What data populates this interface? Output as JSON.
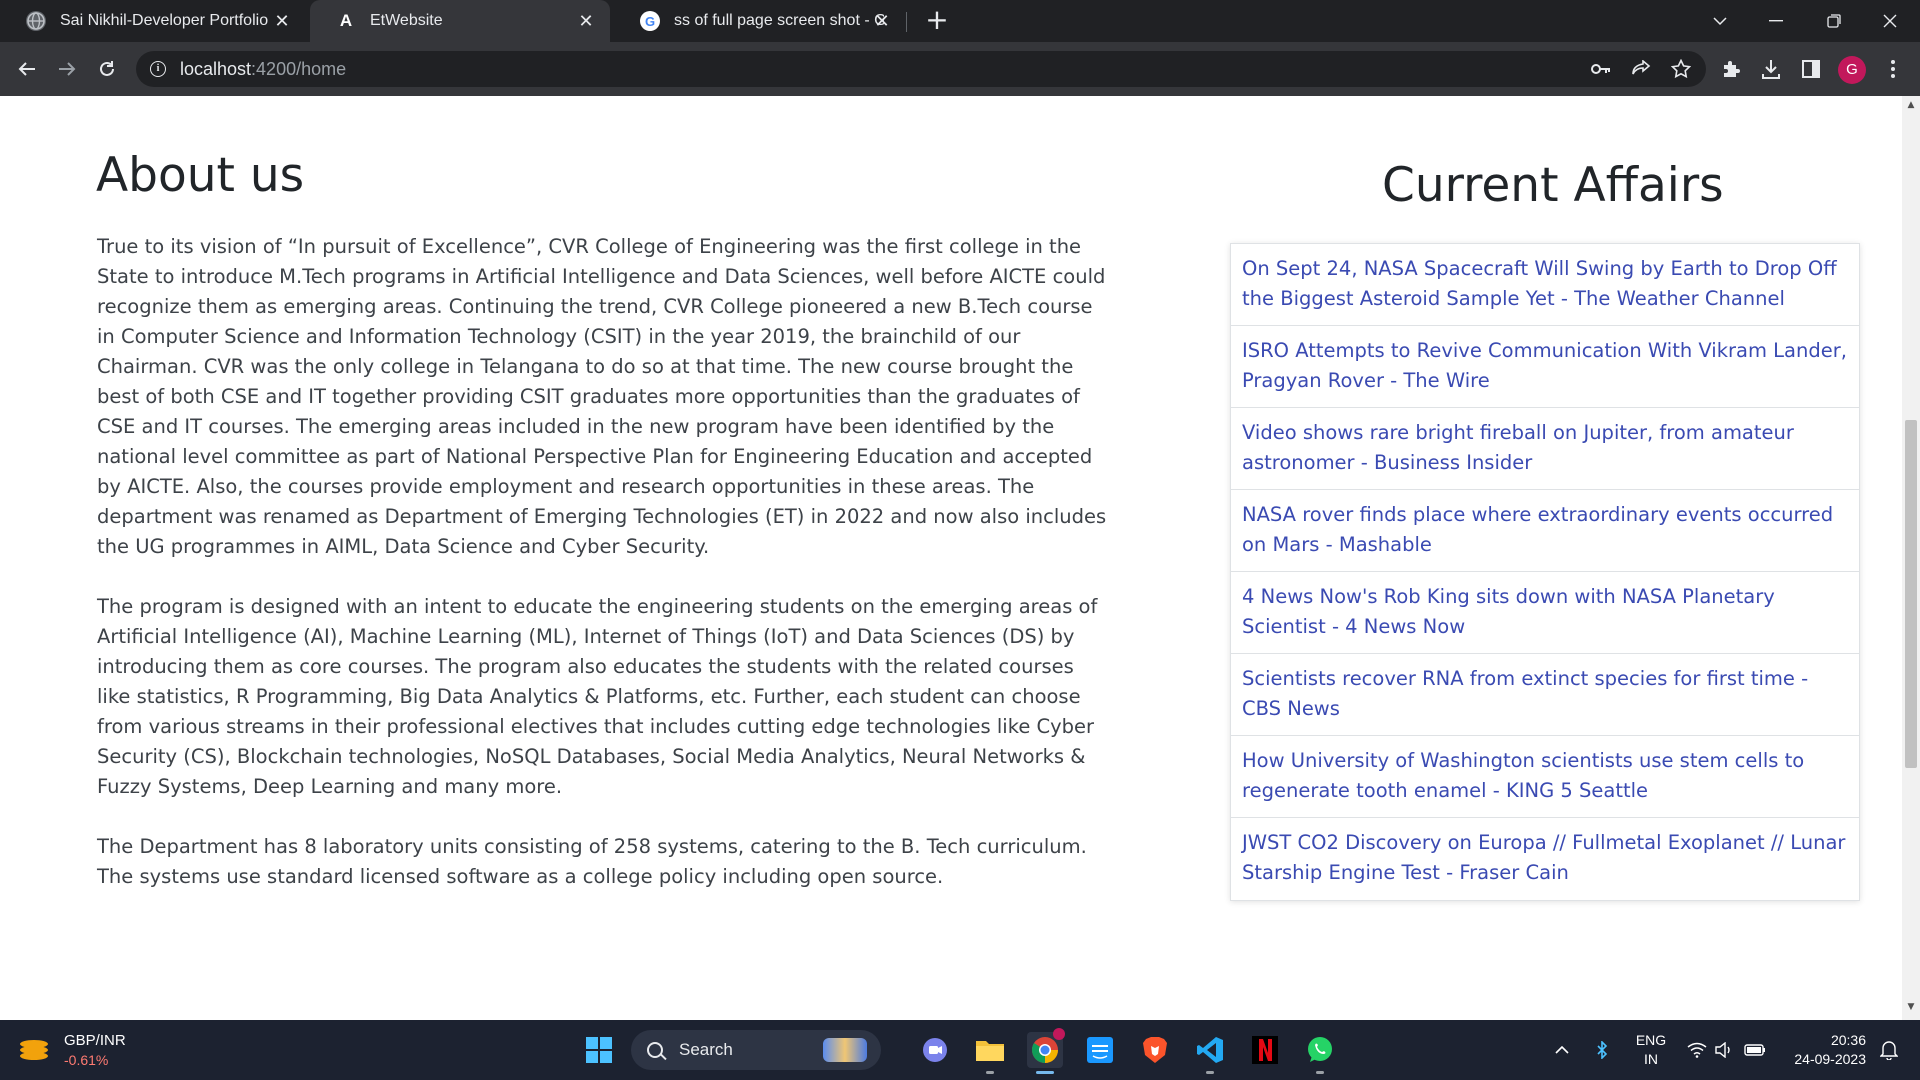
{
  "browser": {
    "tabs": [
      {
        "title": "Sai Nikhil-Developer Portfolio",
        "icon": "globe-icon",
        "active": false
      },
      {
        "title": "EtWebsite",
        "icon": "angular-icon",
        "active": true
      },
      {
        "title": "ss of full page screen shot - Goo",
        "icon": "google-icon",
        "active": false
      }
    ],
    "url_host": "localhost",
    "url_path": ":4200/home",
    "profile_initial": "G",
    "accent": "#c2185b"
  },
  "page": {
    "about_title": "About us",
    "about_paragraphs": [
      "True to its vision of “In pursuit of Excellence”, CVR College of Engineering was the first college in the State to introduce M.Tech programs in Artificial Intelligence and Data Sciences, well before AICTE could recognize them as emerging areas. Continuing the trend, CVR College pioneered a new B.Tech course in Computer Science and Information Technology (CSIT) in the year 2019, the brainchild of our Chairman. CVR was the only college in Telangana to do so at that time. The new course brought the best of both CSE and IT together providing CSIT graduates more opportunities than the graduates of CSE and IT courses. The emerging areas included in the new program have been identified by the national level committee as part of National Perspective Plan for Engineering Education and accepted by AICTE. Also, the courses provide employment and research opportunities in these areas. The department was renamed as Department of Emerging Technologies (ET) in 2022 and now also includes the UG programmes in AIML, Data Science and Cyber Security.",
      "The program is designed with an intent to educate the engineering students on the emerging areas of Artificial Intelligence (AI), Machine Learning (ML), Internet of Things (IoT) and Data Sciences (DS) by introducing them as core courses. The program also educates the students with the related courses like statistics, R Programming, Big Data Analytics & Platforms, etc. Further, each student can choose from various streams in their professional electives that includes cutting edge technologies like Cyber Security (CS), Blockchain technologies, NoSQL Databases, Social Media Analytics, Neural Networks & Fuzzy Systems, Deep Learning and many more.",
      "The Department has 8 laboratory units consisting of 258 systems, catering to the B. Tech curriculum. The systems use standard licensed software as a college policy including open source."
    ],
    "current_affairs_title": "Current Affairs",
    "news": [
      "On Sept 24, NASA Spacecraft Will Swing by Earth to Drop Off the Biggest Asteroid Sample Yet - The Weather Channel",
      "ISRO Attempts to Revive Communication With Vikram Lander, Pragyan Rover - The Wire",
      "Video shows rare bright fireball on Jupiter, from amateur astronomer - Business Insider",
      "NASA rover finds place where extraordinary events occurred on Mars - Mashable",
      "4 News Now's Rob King sits down with NASA Planetary Scientist - 4 News Now",
      "Scientists recover RNA from extinct species for first time - CBS News",
      "How University of Washington scientists use stem cells to regenerate tooth enamel - KING 5 Seattle",
      "JWST CO2 Discovery on Europa // Fullmetal Exoplanet // Lunar Starship Engine Test - Fraser Cain"
    ],
    "link_color": "#3a4ab2"
  },
  "taskbar": {
    "ticker_symbol": "GBP/INR",
    "ticker_change": "-0.61%",
    "search_label": "Search",
    "language": "ENG",
    "region": "IN",
    "time": "20:36",
    "date": "24-09-2023"
  }
}
